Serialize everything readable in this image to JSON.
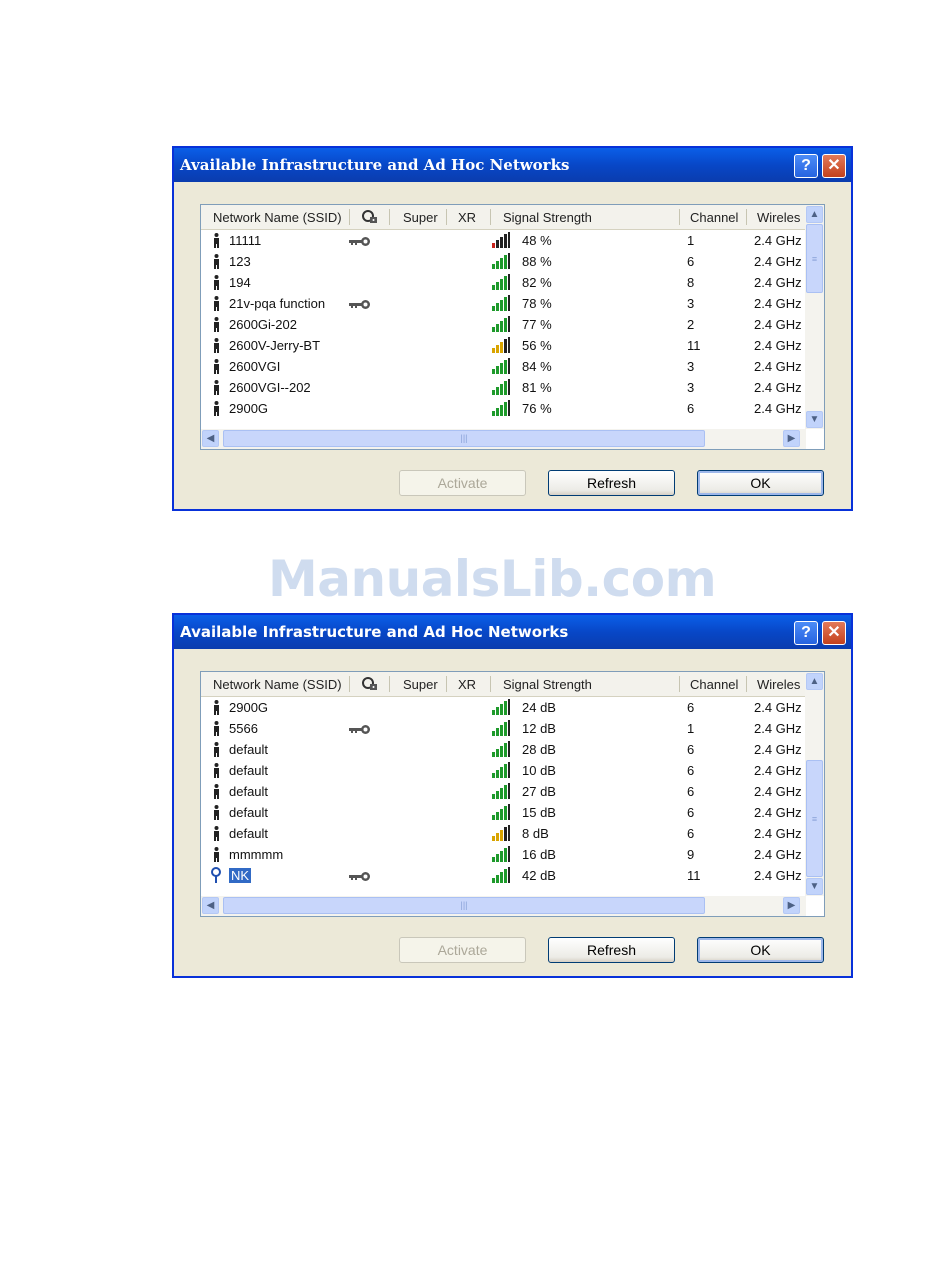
{
  "watermark": "ManualsLib.com",
  "colors": {
    "titlebar": "#0847c7",
    "selection": "#316ac5",
    "signal_green": "#1e9a2b",
    "signal_red": "#c8221b",
    "signal_yellow": "#d9a400"
  },
  "dialogs": [
    {
      "title": "Available Infrastructure and Ad Hoc Networks",
      "columns": {
        "ssid": "Network Name (SSID)",
        "super": "Super",
        "xr": "XR",
        "signal": "Signal Strength",
        "channel": "Channel",
        "wireless": "Wireles"
      },
      "buttons": {
        "activate": "Activate",
        "refresh": "Refresh",
        "ok": "OK"
      },
      "scroll": {
        "vertical_position": 0.0,
        "visible_fraction": 0.37
      },
      "rows": [
        {
          "ssid": "11111",
          "key": true,
          "level": "red",
          "signal": "48 %",
          "channel": "1",
          "band": "2.4 GHz"
        },
        {
          "ssid": "123",
          "key": false,
          "level": "green",
          "signal": "88 %",
          "channel": "6",
          "band": "2.4 GHz"
        },
        {
          "ssid": "194",
          "key": false,
          "level": "green",
          "signal": "82 %",
          "channel": "8",
          "band": "2.4 GHz"
        },
        {
          "ssid": "21v-pqa function",
          "key": true,
          "level": "green",
          "signal": "78 %",
          "channel": "3",
          "band": "2.4 GHz"
        },
        {
          "ssid": "2600Gi-202",
          "key": false,
          "level": "green",
          "signal": "77 %",
          "channel": "2",
          "band": "2.4 GHz"
        },
        {
          "ssid": "2600V-Jerry-BT",
          "key": false,
          "level": "yellow",
          "signal": "56 %",
          "channel": "11",
          "band": "2.4 GHz"
        },
        {
          "ssid": "2600VGI",
          "key": false,
          "level": "green",
          "signal": "84 %",
          "channel": "3",
          "band": "2.4 GHz"
        },
        {
          "ssid": "2600VGI--202",
          "key": false,
          "level": "green",
          "signal": "81 %",
          "channel": "3",
          "band": "2.4 GHz"
        },
        {
          "ssid": "2900G",
          "key": false,
          "level": "green",
          "signal": "76 %",
          "channel": "6",
          "band": "2.4 GHz"
        }
      ]
    },
    {
      "title": "Available Infrastructure and Ad Hoc Networks",
      "columns": {
        "ssid": "Network Name (SSID)",
        "super": "Super",
        "xr": "XR",
        "signal": "Signal Strength",
        "channel": "Channel",
        "wireless": "Wireles"
      },
      "buttons": {
        "activate": "Activate",
        "refresh": "Refresh",
        "ok": "OK"
      },
      "scroll": {
        "vertical_position": 1.0,
        "visible_fraction": 0.63
      },
      "rows": [
        {
          "ssid": "2900G",
          "key": false,
          "level": "green",
          "signal": "24 dB",
          "channel": "6",
          "band": "2.4 GHz"
        },
        {
          "ssid": "5566",
          "key": true,
          "level": "green",
          "signal": "12 dB",
          "channel": "1",
          "band": "2.4 GHz"
        },
        {
          "ssid": "default",
          "key": false,
          "level": "green",
          "signal": "28 dB",
          "channel": "6",
          "band": "2.4 GHz"
        },
        {
          "ssid": "default",
          "key": false,
          "level": "green",
          "signal": "10 dB",
          "channel": "6",
          "band": "2.4 GHz"
        },
        {
          "ssid": "default",
          "key": false,
          "level": "green",
          "signal": "27 dB",
          "channel": "6",
          "band": "2.4 GHz"
        },
        {
          "ssid": "default",
          "key": false,
          "level": "green",
          "signal": "15 dB",
          "channel": "6",
          "band": "2.4 GHz"
        },
        {
          "ssid": "default",
          "key": false,
          "level": "yellow",
          "signal": "8 dB",
          "channel": "6",
          "band": "2.4 GHz"
        },
        {
          "ssid": "mmmmm",
          "key": false,
          "level": "green",
          "signal": "16 dB",
          "channel": "9",
          "band": "2.4 GHz"
        },
        {
          "ssid": "NK",
          "key": true,
          "level": "green",
          "signal": "42 dB",
          "channel": "11",
          "band": "2.4 GHz",
          "infrastructure": true,
          "selected": true
        }
      ]
    }
  ]
}
